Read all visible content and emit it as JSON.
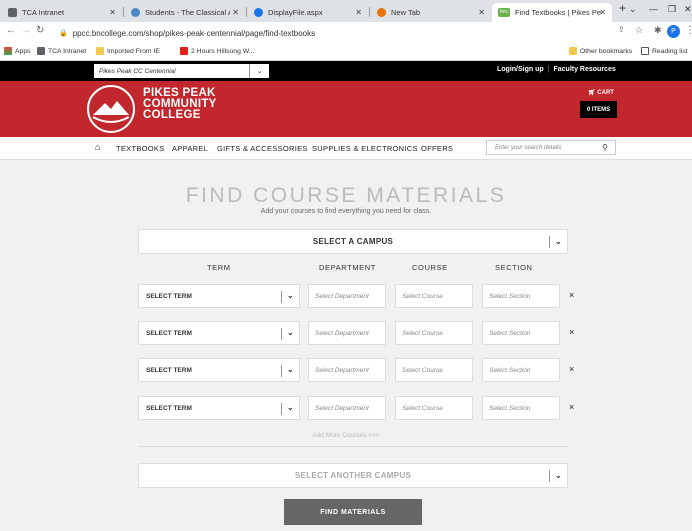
{
  "browser": {
    "tabs": [
      {
        "title": "TCA Intranet",
        "active": false,
        "favicon_color": "#5f6368"
      },
      {
        "title": "Students - The Classical A",
        "active": false,
        "favicon_color": "#4a86c5"
      },
      {
        "title": "DisplayFile.aspx",
        "active": false,
        "favicon_color": "#1a73e8"
      },
      {
        "title": "New Tab",
        "active": false,
        "favicon_color": "#e8710a"
      },
      {
        "title": "Find Textbooks | Pikes Pe",
        "active": true,
        "favicon_color": "#6ab04c",
        "favicon_text": "bnc"
      }
    ],
    "new_tab": "+",
    "url": "ppcc.bncollege.com/shop/pikes-peak-centennial/page/find-textbooks",
    "profile_initial": "P",
    "bookmarks": [
      "Apps",
      "TCA Intranet",
      "Imported From IE",
      "2 Hours Hillsong W..."
    ],
    "bookmarks_right": [
      "Other bookmarks",
      "Reading list"
    ]
  },
  "site": {
    "campus_dropdown": "Pikes Peak CC Centennial",
    "login": "Login/Sign up",
    "faculty": "Faculty Resources",
    "logo_lines": [
      "PIKES PEAK",
      "COMMUNITY",
      "COLLEGE"
    ],
    "cart_label": "CART",
    "cart_items": "0 ITEMS",
    "nav": [
      "TEXTBOOKS",
      "APPAREL",
      "GIFTS & ACCESSORIES",
      "SUPPLIES & ELECTRONICS",
      "OFFERS"
    ],
    "search_placeholder": "Enter your search details",
    "brand_red": "#c1272d"
  },
  "main": {
    "title": "FIND COURSE MATERIALS",
    "subtitle": "Add your courses to find everything you need for class.",
    "select_campus": "SELECT A CAMPUS",
    "columns": [
      "TERM",
      "DEPARTMENT",
      "COURSE",
      "SECTION"
    ],
    "rows": [
      {
        "term": "SELECT TERM",
        "department": "Select Department",
        "course": "Select Course",
        "section": "Select Section"
      },
      {
        "term": "SELECT TERM",
        "department": "Select Department",
        "course": "Select Course",
        "section": "Select Section"
      },
      {
        "term": "SELECT TERM",
        "department": "Select Department",
        "course": "Select Course",
        "section": "Select Section"
      },
      {
        "term": "SELECT TERM",
        "department": "Select Department",
        "course": "Select Course",
        "section": "Select Section"
      }
    ],
    "remove_symbol": "×",
    "add_more": "Add More Courses >>>",
    "select_another": "SELECT ANOTHER CAMPUS",
    "find_button": "FIND MATERIALS"
  }
}
